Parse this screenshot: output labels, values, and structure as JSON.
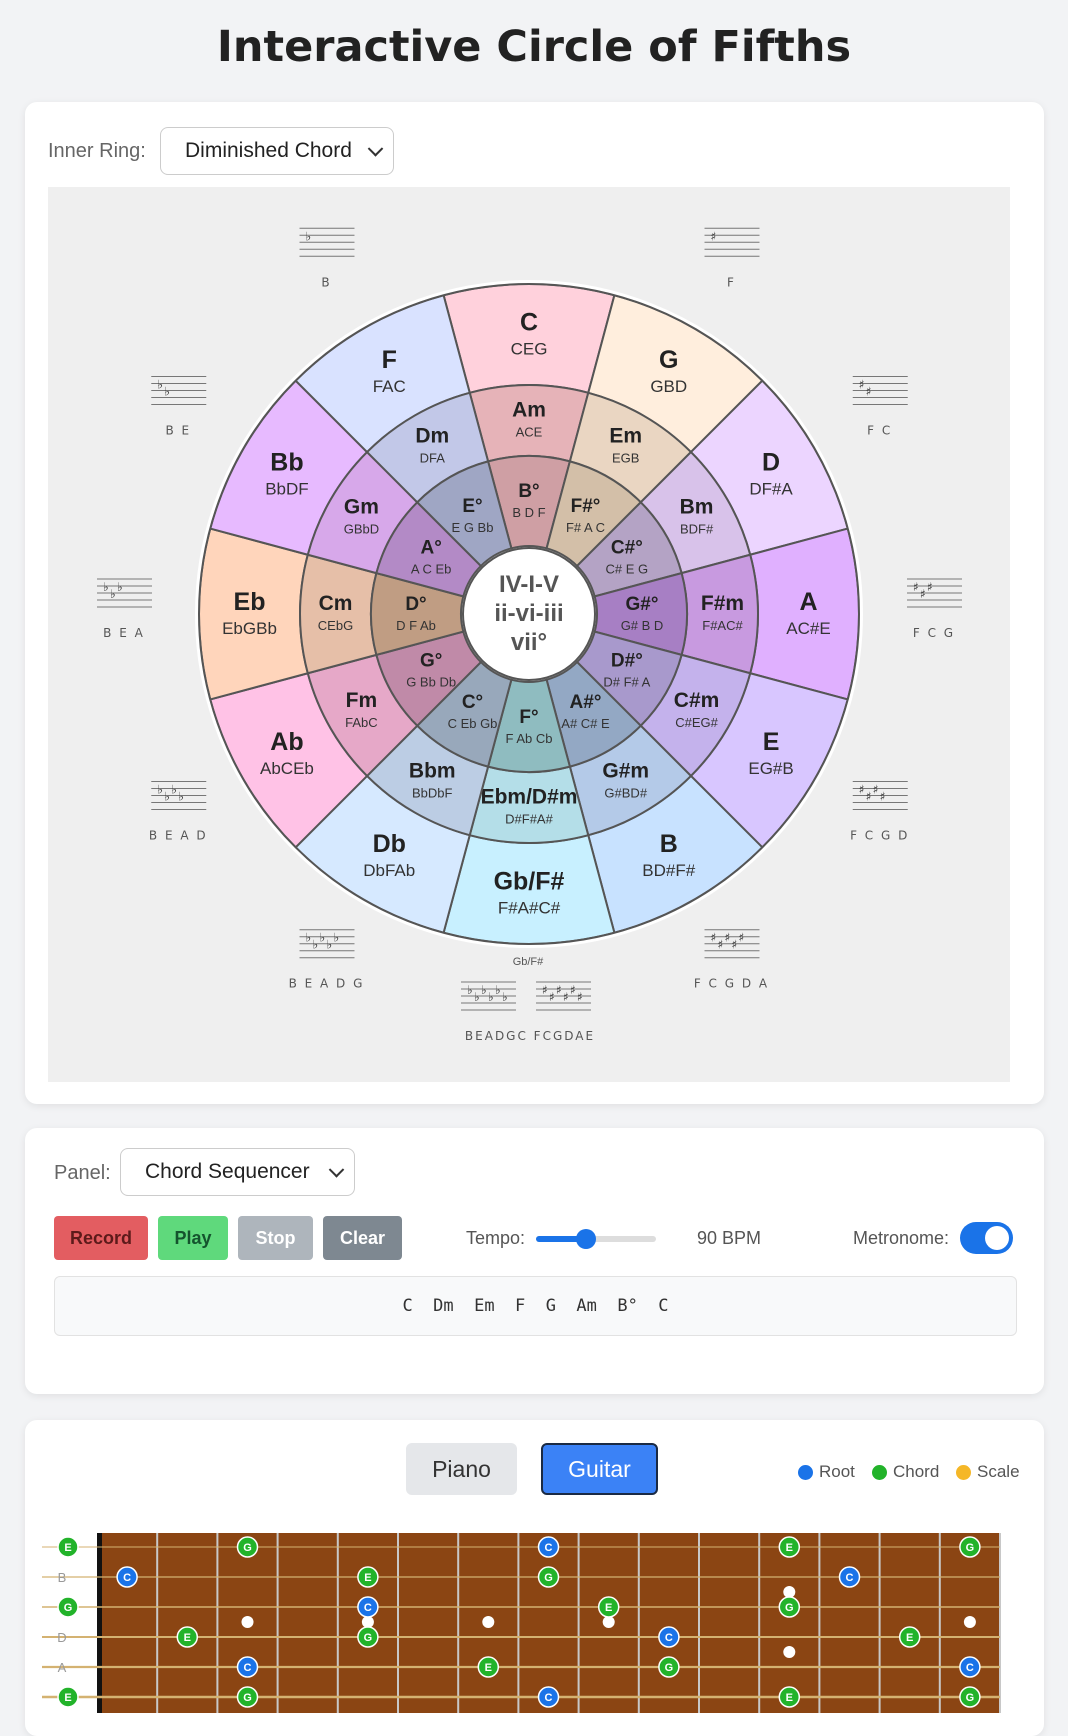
{
  "page_title": "Interactive Circle of Fifths",
  "inner_ring": {
    "label": "Inner Ring:",
    "value": "Diminished Chord"
  },
  "center": {
    "line1": "IV-I-V",
    "line2": "ii-vi-iii",
    "line3": "vii°"
  },
  "outer_ring": [
    {
      "name": "C",
      "notes": "CEG",
      "color": "#ffd1dc"
    },
    {
      "name": "G",
      "notes": "GBD",
      "color": "#ffeedd"
    },
    {
      "name": "D",
      "notes": "DF#A",
      "color": "#ecd5ff"
    },
    {
      "name": "A",
      "notes": "AC#E",
      "color": "#e0b0ff"
    },
    {
      "name": "E",
      "notes": "EG#B",
      "color": "#d8c6ff"
    },
    {
      "name": "B",
      "notes": "BD#F#",
      "color": "#c8e2ff"
    },
    {
      "name": "Gb/F#",
      "notes": "F#A#C#",
      "color": "#c8f0ff"
    },
    {
      "name": "Db",
      "notes": "DbFAb",
      "color": "#d6e9ff"
    },
    {
      "name": "Ab",
      "notes": "AbCEb",
      "color": "#ffc2e6"
    },
    {
      "name": "Eb",
      "notes": "EbGBb",
      "color": "#ffd5bb"
    },
    {
      "name": "Bb",
      "notes": "BbDF",
      "color": "#e7baff"
    },
    {
      "name": "F",
      "notes": "FAC",
      "color": "#d9e2ff"
    }
  ],
  "middle_ring": [
    {
      "name": "Am",
      "notes": "ACE",
      "color": "#e6b3b8"
    },
    {
      "name": "Em",
      "notes": "EGB",
      "color": "#ead6c2"
    },
    {
      "name": "Bm",
      "notes": "BDF#",
      "color": "#d8c2ea"
    },
    {
      "name": "F#m",
      "notes": "F#AC#",
      "color": "#c89ae0"
    },
    {
      "name": "C#m",
      "notes": "C#EG#",
      "color": "#c4b2ec"
    },
    {
      "name": "G#m",
      "notes": "G#BD#",
      "color": "#b4cae8"
    },
    {
      "name": "Ebm/D#m",
      "notes": "D#F#A#",
      "color": "#b4dee8"
    },
    {
      "name": "Bbm",
      "notes": "BbDbF",
      "color": "#bccde4"
    },
    {
      "name": "Fm",
      "notes": "FAbC",
      "color": "#e6a8c8"
    },
    {
      "name": "Cm",
      "notes": "CEbG",
      "color": "#e6bfa8"
    },
    {
      "name": "Gm",
      "notes": "GBbD",
      "color": "#d7a8ea"
    },
    {
      "name": "Dm",
      "notes": "DFA",
      "color": "#c2c8e8"
    }
  ],
  "inner_ring_chords": [
    {
      "name": "B°",
      "notes": "B D F",
      "color": "#cf9fa4"
    },
    {
      "name": "F#°",
      "notes": "F# A C",
      "color": "#d3bfa8"
    },
    {
      "name": "C#°",
      "notes": "C# E G",
      "color": "#b4a3c5"
    },
    {
      "name": "G#°",
      "notes": "G# B D",
      "color": "#a77fc4"
    },
    {
      "name": "D#°",
      "notes": "D# F# A",
      "color": "#a899cc"
    },
    {
      "name": "A#°",
      "notes": "A# C# E",
      "color": "#93a8c4"
    },
    {
      "name": "F°",
      "notes": "F Ab Cb",
      "color": "#8fbcc0"
    },
    {
      "name": "C°",
      "notes": "C Eb Gb",
      "color": "#98a8bb"
    },
    {
      "name": "G°",
      "notes": "G Bb Db",
      "color": "#c08aa8"
    },
    {
      "name": "D°",
      "notes": "D F Ab",
      "color": "#c09d83"
    },
    {
      "name": "A°",
      "notes": "A C Eb",
      "color": "#b38ac6"
    },
    {
      "name": "E°",
      "notes": "E G Bb",
      "color": "#9fa6c4"
    }
  ],
  "key_signatures": [
    {
      "id": "G",
      "sym": "#",
      "count": 1,
      "label": "F"
    },
    {
      "id": "D",
      "sym": "#",
      "count": 2,
      "label": "F C"
    },
    {
      "id": "A",
      "sym": "#",
      "count": 3,
      "label": "F C G"
    },
    {
      "id": "E",
      "sym": "#",
      "count": 4,
      "label": "F C G D"
    },
    {
      "id": "B",
      "sym": "#",
      "count": 5,
      "label": "F C G D A"
    },
    {
      "id": "Gb-flat",
      "sym": "b",
      "count": 6,
      "label": "B E A D G C"
    },
    {
      "id": "F#-sharp",
      "sym": "#",
      "count": 6,
      "label": "F C G D A E"
    },
    {
      "id": "Db",
      "sym": "b",
      "count": 5,
      "label": "B E A D G"
    },
    {
      "id": "Ab",
      "sym": "b",
      "count": 4,
      "label": "B E A D"
    },
    {
      "id": "Eb",
      "sym": "b",
      "count": 3,
      "label": "B E A"
    },
    {
      "id": "Bb",
      "sym": "b",
      "count": 2,
      "label": "B E"
    },
    {
      "id": "F",
      "sym": "b",
      "count": 1,
      "label": "B"
    }
  ],
  "gbfs_caption": "Gb/F#",
  "panel": {
    "label": "Panel:",
    "value": "Chord Sequencer"
  },
  "sequencer": {
    "record": "Record",
    "play": "Play",
    "stop": "Stop",
    "clear": "Clear",
    "tempo_label": "Tempo:",
    "tempo_value": 0.42,
    "bpm": "90 BPM",
    "metronome_label": "Metronome:",
    "metronome_on": true,
    "sequence": "C  Dm  Em  F  G  Am  B°  C"
  },
  "instrument": {
    "piano": "Piano",
    "guitar": "Guitar",
    "active": "Guitar"
  },
  "legend": [
    {
      "label": "Root",
      "color": "#1a73e8"
    },
    {
      "label": "Chord",
      "color": "#22b32a"
    },
    {
      "label": "Scale",
      "color": "#f5b727"
    }
  ],
  "colors": {
    "root": "#1a73e8",
    "chord": "#22b32a",
    "fretboard": "#8b4513"
  },
  "fretboard": {
    "strings": [
      "E",
      "B",
      "G",
      "D",
      "A",
      "E"
    ],
    "open_markers": [
      {
        "string": 0,
        "note": "E",
        "type": "chord"
      },
      {
        "string": 2,
        "note": "G",
        "type": "chord"
      },
      {
        "string": 5,
        "note": "E",
        "type": "chord"
      }
    ],
    "inlays_single": [
      3,
      5,
      7,
      9,
      15,
      17,
      19
    ],
    "inlays_double": [
      12
    ],
    "notes": [
      {
        "string": 0,
        "fret": 3,
        "note": "G",
        "type": "chord"
      },
      {
        "string": 0,
        "fret": 8,
        "note": "C",
        "type": "root"
      },
      {
        "string": 0,
        "fret": 12,
        "note": "E",
        "type": "chord"
      },
      {
        "string": 0,
        "fret": 15,
        "note": "G",
        "type": "chord"
      },
      {
        "string": 1,
        "fret": 1,
        "note": "C",
        "type": "root"
      },
      {
        "string": 1,
        "fret": 5,
        "note": "E",
        "type": "chord"
      },
      {
        "string": 1,
        "fret": 8,
        "note": "G",
        "type": "chord"
      },
      {
        "string": 1,
        "fret": 13,
        "note": "C",
        "type": "root"
      },
      {
        "string": 2,
        "fret": 5,
        "note": "C",
        "type": "root"
      },
      {
        "string": 2,
        "fret": 9,
        "note": "E",
        "type": "chord"
      },
      {
        "string": 2,
        "fret": 12,
        "note": "G",
        "type": "chord"
      },
      {
        "string": 3,
        "fret": 2,
        "note": "E",
        "type": "chord"
      },
      {
        "string": 3,
        "fret": 5,
        "note": "G",
        "type": "chord"
      },
      {
        "string": 3,
        "fret": 10,
        "note": "C",
        "type": "root"
      },
      {
        "string": 3,
        "fret": 14,
        "note": "E",
        "type": "chord"
      },
      {
        "string": 4,
        "fret": 3,
        "note": "C",
        "type": "root"
      },
      {
        "string": 4,
        "fret": 7,
        "note": "E",
        "type": "chord"
      },
      {
        "string": 4,
        "fret": 10,
        "note": "G",
        "type": "chord"
      },
      {
        "string": 4,
        "fret": 15,
        "note": "C",
        "type": "root"
      },
      {
        "string": 5,
        "fret": 3,
        "note": "G",
        "type": "chord"
      },
      {
        "string": 5,
        "fret": 8,
        "note": "C",
        "type": "root"
      },
      {
        "string": 5,
        "fret": 12,
        "note": "E",
        "type": "chord"
      },
      {
        "string": 5,
        "fret": 15,
        "note": "G",
        "type": "chord"
      }
    ]
  }
}
